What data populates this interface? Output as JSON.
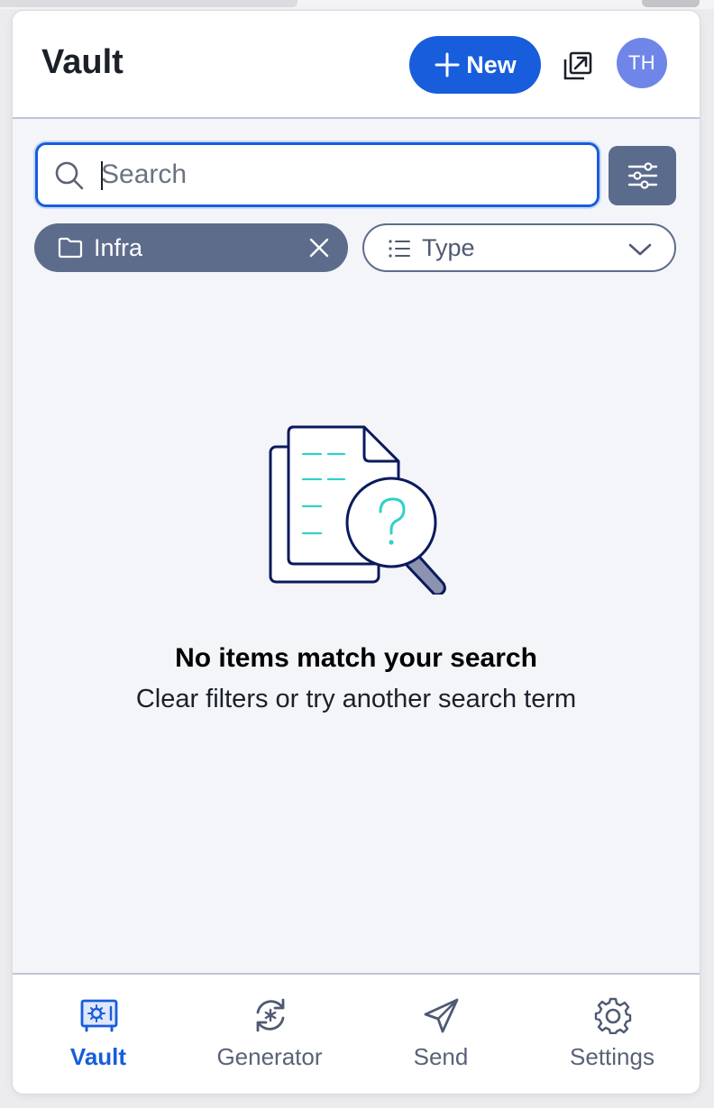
{
  "header": {
    "title": "Vault",
    "new_label": "New",
    "avatar_initials": "TH"
  },
  "search": {
    "placeholder": "Search",
    "value": ""
  },
  "filters": {
    "folder_label": "Infra",
    "type_label": "Type"
  },
  "empty_state": {
    "title": "No items match your search",
    "subtitle": "Clear filters or try another search term"
  },
  "nav": {
    "items": [
      {
        "label": "Vault",
        "icon": "vault-icon",
        "active": true
      },
      {
        "label": "Generator",
        "icon": "generator-icon",
        "active": false
      },
      {
        "label": "Send",
        "icon": "send-icon",
        "active": false
      },
      {
        "label": "Settings",
        "icon": "gear-icon",
        "active": false
      }
    ]
  },
  "colors": {
    "accent": "#175ddc",
    "chip": "#5e6c8b",
    "background": "#f3f5f9",
    "avatar": "#6f86e8"
  }
}
